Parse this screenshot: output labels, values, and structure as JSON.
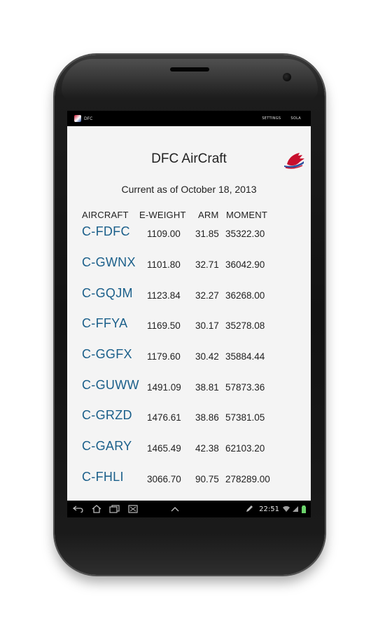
{
  "status_bar": {
    "app_label": "DFC",
    "actions": [
      "SETTINGS",
      "SOLA"
    ]
  },
  "app": {
    "title": "DFC AirCraft",
    "subtitle": "Current as of October 18, 2013"
  },
  "columns": [
    "AIRCRAFT",
    "E-WEIGHT",
    "ARM",
    "MOMENT"
  ],
  "aircraft": [
    {
      "reg": "C-FDFC",
      "weight": "1109.00",
      "arm": "31.85",
      "moment": "35322.30"
    },
    {
      "reg": "C-GWNX",
      "weight": "1101.80",
      "arm": "32.71",
      "moment": "36042.90"
    },
    {
      "reg": "C-GQJM",
      "weight": "1123.84",
      "arm": "32.27",
      "moment": "36268.00"
    },
    {
      "reg": "C-FFYA",
      "weight": "1169.50",
      "arm": "30.17",
      "moment": "35278.08"
    },
    {
      "reg": "C-GGFX",
      "weight": "1179.60",
      "arm": "30.42",
      "moment": "35884.44"
    },
    {
      "reg": "C-GUWW",
      "weight": "1491.09",
      "arm": "38.81",
      "moment": "57873.36"
    },
    {
      "reg": "C-GRZD",
      "weight": "1476.61",
      "arm": "38.86",
      "moment": "57381.05"
    },
    {
      "reg": "C-GARY",
      "weight": "1465.49",
      "arm": "42.38",
      "moment": "62103.20"
    },
    {
      "reg": "C-FHLI",
      "weight": "3066.70",
      "arm": "90.75",
      "moment": "278289.00"
    }
  ],
  "nav_bar": {
    "time": "22:51",
    "icons": [
      "back-icon",
      "home-icon",
      "recents-icon",
      "screenshot-icon",
      "chevron-up-icon",
      "edit-icon",
      "wifi-icon",
      "signal-icon",
      "battery-icon"
    ]
  },
  "colors": {
    "link": "#1a5f8a",
    "text": "#222222",
    "screen_bg": "#f4f4f4",
    "bar_bg": "#000000"
  }
}
